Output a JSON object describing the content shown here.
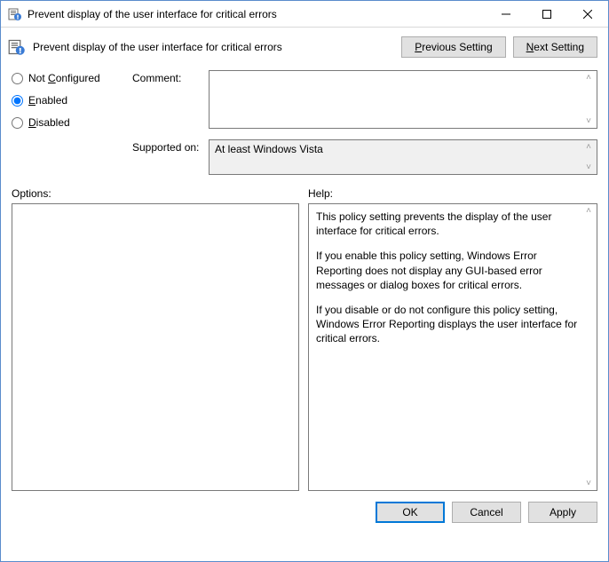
{
  "titlebar": {
    "title": "Prevent display of the user interface for critical errors"
  },
  "header": {
    "policy_title": "Prevent display of the user interface for critical errors",
    "prev_button": "Previous Setting",
    "next_button": "Next Setting"
  },
  "radios": {
    "not_configured": "Not Configured",
    "enabled": "Enabled",
    "disabled": "Disabled",
    "selected": "enabled"
  },
  "labels": {
    "comment": "Comment:",
    "supported_on": "Supported on:",
    "options": "Options:",
    "help": "Help:"
  },
  "comment_value": "",
  "supported_on_value": "At least Windows Vista",
  "help_paragraphs": [
    "This policy setting prevents the display of the user interface for critical errors.",
    "If you enable this policy setting, Windows Error Reporting does not display any GUI-based error messages or dialog boxes for critical errors.",
    "If you disable or do not configure this policy setting, Windows Error Reporting displays the user interface for critical errors."
  ],
  "footer": {
    "ok": "OK",
    "cancel": "Cancel",
    "apply": "Apply"
  }
}
